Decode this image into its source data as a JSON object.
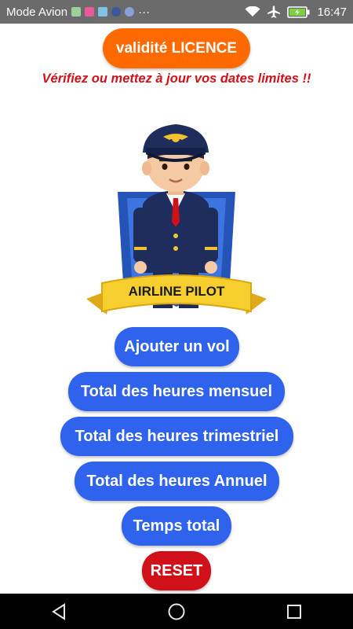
{
  "status_bar": {
    "carrier": "Mode Avion",
    "more": "···",
    "time": "16:47"
  },
  "header": {
    "licence_button": "validité LICENCE",
    "subtitle": "Vérifiez ou  mettez à jour vos dates limites !!"
  },
  "illustration": {
    "banner_text": "AIRLINE PILOT"
  },
  "menu": {
    "add_flight": "Ajouter un vol",
    "monthly": "Total des heures mensuel",
    "quarterly": "Total des heures trimestriel",
    "annual": "Total des heures Annuel",
    "total": "Temps total",
    "reset": "RESET"
  },
  "colors": {
    "status_bar": "#6b6b6b",
    "accent_orange": "#ff6a00",
    "button_blue": "#2f63ee",
    "reset_red": "#d0111a",
    "subtitle_red": "#d0111a"
  }
}
